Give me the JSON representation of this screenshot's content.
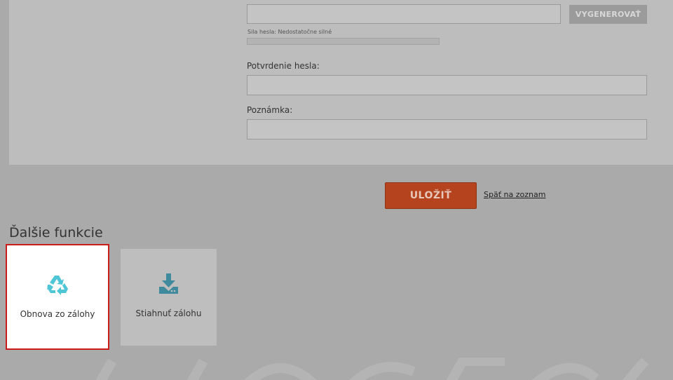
{
  "form": {
    "password_value": "",
    "generate_label": "VYGENEROVAŤ",
    "strength_text": "Sila hesla: Nedostatočne silné",
    "strength_percent": 0,
    "confirm_label": "Potvrdenie hesla:",
    "confirm_value": "",
    "note_label": "Poznámka:",
    "note_value": ""
  },
  "actions": {
    "save_label": "ULOŽIŤ",
    "back_label": "Späť na zoznam"
  },
  "more_functions": {
    "title": "Ďalšie funkcie",
    "tiles": [
      {
        "label": "Obnova zo zálohy",
        "icon": "recycle-icon",
        "selected": true
      },
      {
        "label": "Stiahnuť zálohu",
        "icon": "download-icon",
        "selected": false
      }
    ]
  },
  "colors": {
    "overlay": "#aaaaaa",
    "panel": "#bdbdbd",
    "save_button": "#b5431d",
    "highlight_border": "#cc1b1b",
    "restore_icon": "#4fc6d6",
    "download_icon": "#3f8a9c"
  }
}
